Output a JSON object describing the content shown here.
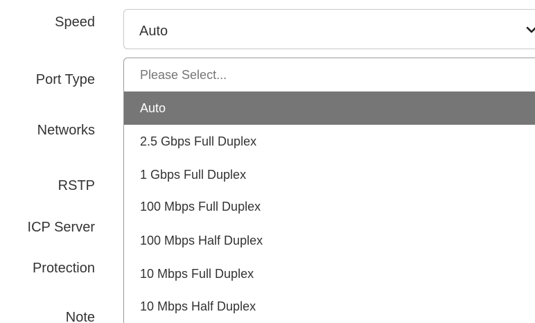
{
  "form": {
    "labels": {
      "speed": "Speed",
      "port_type": "Port Type",
      "networks": "Networks",
      "rstp": "RSTP",
      "dhcp_server": "ICP Server",
      "protection": "Protection",
      "note": "Note"
    },
    "speed_select": {
      "value": "Auto",
      "icon": "chevron-down-icon",
      "options": [
        "Please Select...",
        "Auto",
        "2.5 Gbps Full Duplex",
        "1 Gbps Full Duplex",
        "100 Mbps Full Duplex",
        "100 Mbps Half Duplex",
        "10 Mbps Full Duplex",
        "10 Mbps Half Duplex"
      ],
      "selected_option": "Auto"
    }
  },
  "colors": {
    "highlight_bg": "#767676",
    "highlight_text": "#ffffff",
    "border": "#c8c8c8"
  }
}
